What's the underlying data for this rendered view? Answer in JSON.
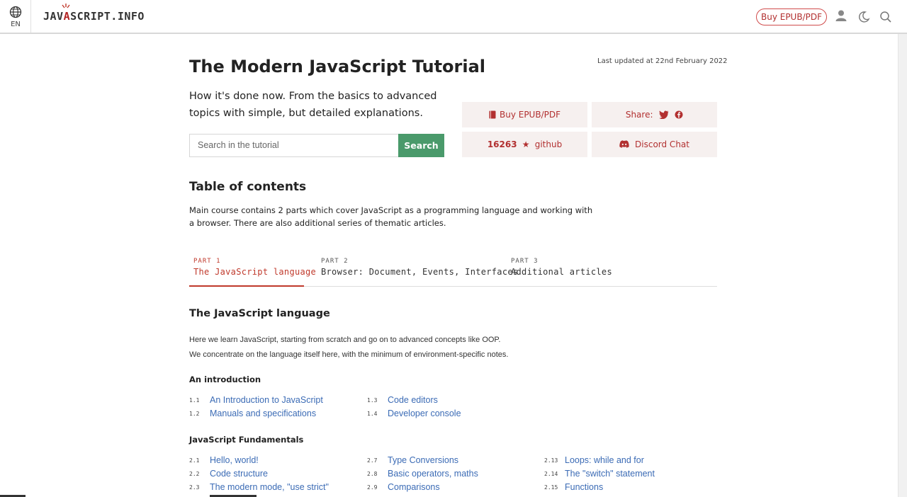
{
  "header": {
    "lang_code": "EN",
    "logo_pre": "JAV",
    "logo_accent": "A",
    "logo_post": "SCRIPT.INFO",
    "buy_label": "Buy EPUB/PDF",
    "icons": [
      "globe-icon",
      "user-icon",
      "moon-icon",
      "search-icon"
    ]
  },
  "hero": {
    "title": "The Modern JavaScript Tutorial",
    "updated": "Last updated at 22nd February 2022",
    "subtitle": "How it's done now. From the basics to advanced topics with simple, but detailed explanations.",
    "search_placeholder": "Search in the tutorial",
    "search_button": "Search",
    "buy_label": "Buy EPUB/PDF",
    "share_label": "Share:",
    "github_count": "16263",
    "github_label": "github",
    "discord_label": "Discord Chat"
  },
  "toc": {
    "title": "Table of contents",
    "description": "Main course contains 2 parts which cover JavaScript as a programming language and working with a browser. There are also additional series of thematic articles.",
    "tabs": [
      {
        "part": "PART 1",
        "name": "The JavaScript language"
      },
      {
        "part": "PART 2",
        "name": "Browser: Document, Events, Interfaces"
      },
      {
        "part": "PART 3",
        "name": "Additional articles"
      }
    ]
  },
  "section": {
    "title": "The JavaScript language",
    "p1": "Here we learn JavaScript, starting from scratch and go on to advanced concepts like OOP.",
    "p2": "We concentrate on the language itself here, with the minimum of environment-specific notes.",
    "chapters": [
      {
        "title": "An introduction",
        "items": [
          {
            "num": "1.1",
            "label": "An Introduction to JavaScript"
          },
          {
            "num": "1.2",
            "label": "Manuals and specifications"
          },
          {
            "num": "1.3",
            "label": "Code editors"
          },
          {
            "num": "1.4",
            "label": "Developer console"
          }
        ]
      },
      {
        "title": "JavaScript Fundamentals",
        "items": [
          {
            "num": "2.1",
            "label": "Hello, world!"
          },
          {
            "num": "2.2",
            "label": "Code structure"
          },
          {
            "num": "2.3",
            "label": "The modern mode, \"use strict\""
          },
          {
            "num": "2.7",
            "label": "Type Conversions"
          },
          {
            "num": "2.8",
            "label": "Basic operators, maths"
          },
          {
            "num": "2.9",
            "label": "Comparisons"
          },
          {
            "num": "2.13",
            "label": "Loops: while and for"
          },
          {
            "num": "2.14",
            "label": "The \"switch\" statement"
          },
          {
            "num": "2.15",
            "label": "Functions"
          }
        ]
      }
    ]
  },
  "colors": {
    "accent": "#c0392b",
    "link": "#3b6bb5",
    "search_button": "#4a9a6b",
    "box_bg": "#f6f0ef"
  }
}
